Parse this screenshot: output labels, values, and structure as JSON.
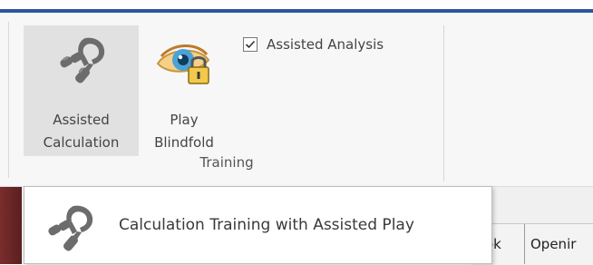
{
  "ribbon": {
    "buttons": [
      {
        "label_line1": "Assisted",
        "label_line2": "Calculation",
        "icon": "hand-grip-icon",
        "selected": true
      },
      {
        "label_line1": "Play",
        "label_line2": "Blindfold",
        "icon": "eye-lock-icon",
        "selected": false
      }
    ],
    "checkbox": {
      "label": "Assisted Analysis",
      "checked": true
    },
    "group_label": "Training"
  },
  "tabs": [
    {
      "label": "ok"
    },
    {
      "label": "Openir"
    }
  ],
  "tooltip": {
    "text": "Calculation Training with Assisted Play",
    "icon": "hand-grip-icon"
  },
  "colors": {
    "accent": "#2b579a",
    "ribbon_bg": "#f7f7f7",
    "selected_bg": "#e1e1e1"
  }
}
